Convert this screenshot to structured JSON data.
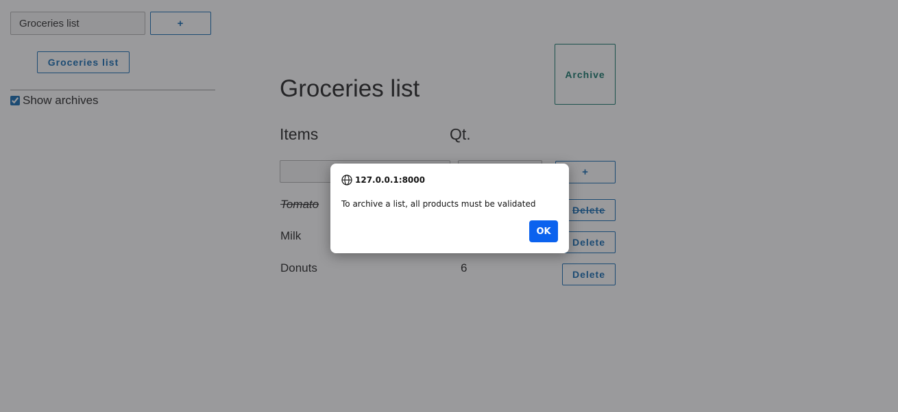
{
  "sidebar": {
    "new_list_value": "Groceries list",
    "add_label": "+",
    "lists": [
      {
        "label": "Groceries list"
      }
    ],
    "show_archives_label": "Show archives",
    "show_archives_checked": true
  },
  "main": {
    "title": "Groceries list",
    "archive_label": "Archive",
    "items_header": "Items",
    "qty_header": "Qt.",
    "add_label": "+",
    "new_item_placeholder": "",
    "new_qty_placeholder": "",
    "rows": [
      {
        "name": "Tomato",
        "qty": "",
        "validated": true,
        "delete_label": "Delete"
      },
      {
        "name": "Milk",
        "qty": "",
        "validated": false,
        "delete_label": "Delete"
      },
      {
        "name": "Donuts",
        "qty": "6",
        "validated": false,
        "delete_label": "Delete"
      }
    ]
  },
  "dialog": {
    "origin": "127.0.0.1:8000",
    "message": "To archive a list, all products must be validated",
    "ok_label": "OK",
    "icon": "globe-icon"
  },
  "colors": {
    "accent": "#1a6fb5",
    "archive_text": "#1a7a6e",
    "ok_button": "#0b62ee",
    "overlay": "rgba(30,30,35,0.45)"
  }
}
